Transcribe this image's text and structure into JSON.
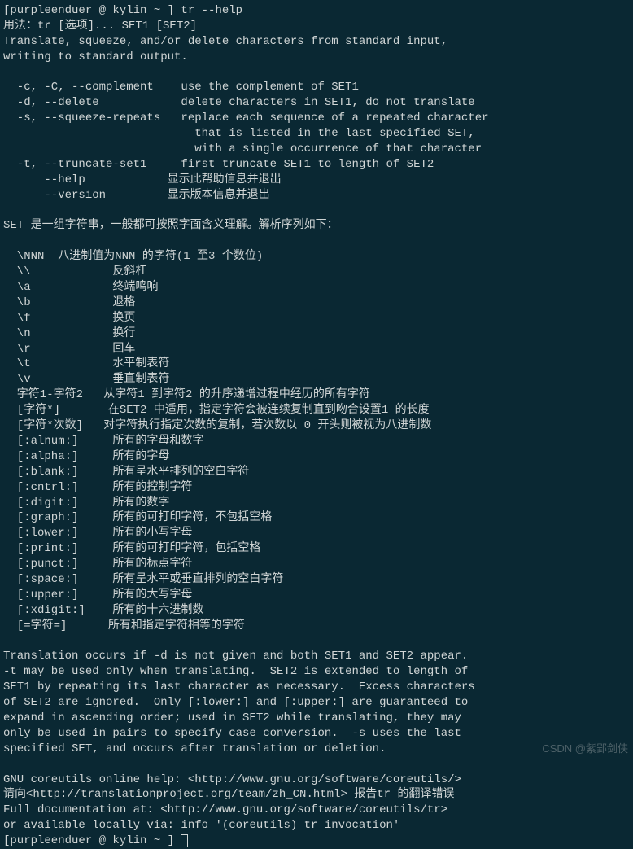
{
  "prompt1": "[purpleenduer @ kylin ~ ] tr --help",
  "lines": [
    "用法：tr [选项]... SET1 [SET2]",
    "Translate, squeeze, and/or delete characters from standard input,",
    "writing to standard output.",
    "",
    "  -c, -C, --complement    use the complement of SET1",
    "  -d, --delete            delete characters in SET1, do not translate",
    "  -s, --squeeze-repeats   replace each sequence of a repeated character",
    "                            that is listed in the last specified SET,",
    "                            with a single occurrence of that character",
    "  -t, --truncate-set1     first truncate SET1 to length of SET2",
    "      --help            显示此帮助信息并退出",
    "      --version         显示版本信息并退出",
    "",
    "SET 是一组字符串，一般都可按照字面含义理解。解析序列如下：",
    "",
    "  \\NNN  八进制值为NNN 的字符(1 至3 个数位)",
    "  \\\\            反斜杠",
    "  \\a            终端鸣响",
    "  \\b            退格",
    "  \\f            换页",
    "  \\n            换行",
    "  \\r            回车",
    "  \\t            水平制表符",
    "  \\v            垂直制表符",
    "  字符1-字符2   从字符1 到字符2 的升序递增过程中经历的所有字符",
    "  [字符*]       在SET2 中适用，指定字符会被连续复制直到吻合设置1 的长度",
    "  [字符*次数]   对字符执行指定次数的复制，若次数以 0 开头则被视为八进制数",
    "  [:alnum:]     所有的字母和数字",
    "  [:alpha:]     所有的字母",
    "  [:blank:]     所有呈水平排列的空白字符",
    "  [:cntrl:]     所有的控制字符",
    "  [:digit:]     所有的数字",
    "  [:graph:]     所有的可打印字符，不包括空格",
    "  [:lower:]     所有的小写字母",
    "  [:print:]     所有的可打印字符，包括空格",
    "  [:punct:]     所有的标点字符",
    "  [:space:]     所有呈水平或垂直排列的空白字符",
    "  [:upper:]     所有的大写字母",
    "  [:xdigit:]    所有的十六进制数",
    "  [=字符=]      所有和指定字符相等的字符",
    "",
    "Translation occurs if -d is not given and both SET1 and SET2 appear.",
    "-t may be used only when translating.  SET2 is extended to length of",
    "SET1 by repeating its last character as necessary.  Excess characters",
    "of SET2 are ignored.  Only [:lower:] and [:upper:] are guaranteed to",
    "expand in ascending order; used in SET2 while translating, they may",
    "only be used in pairs to specify case conversion.  -s uses the last",
    "specified SET, and occurs after translation or deletion.",
    "",
    "GNU coreutils online help: <http://www.gnu.org/software/coreutils/>",
    "请向<http://translationproject.org/team/zh_CN.html> 报告tr 的翻译错误",
    "Full documentation at: <http://www.gnu.org/software/coreutils/tr>",
    "or available locally via: info '(coreutils) tr invocation'"
  ],
  "prompt2": "[purpleenduer @ kylin ~ ] ",
  "watermark": "CSDN @紫郢剑侠"
}
